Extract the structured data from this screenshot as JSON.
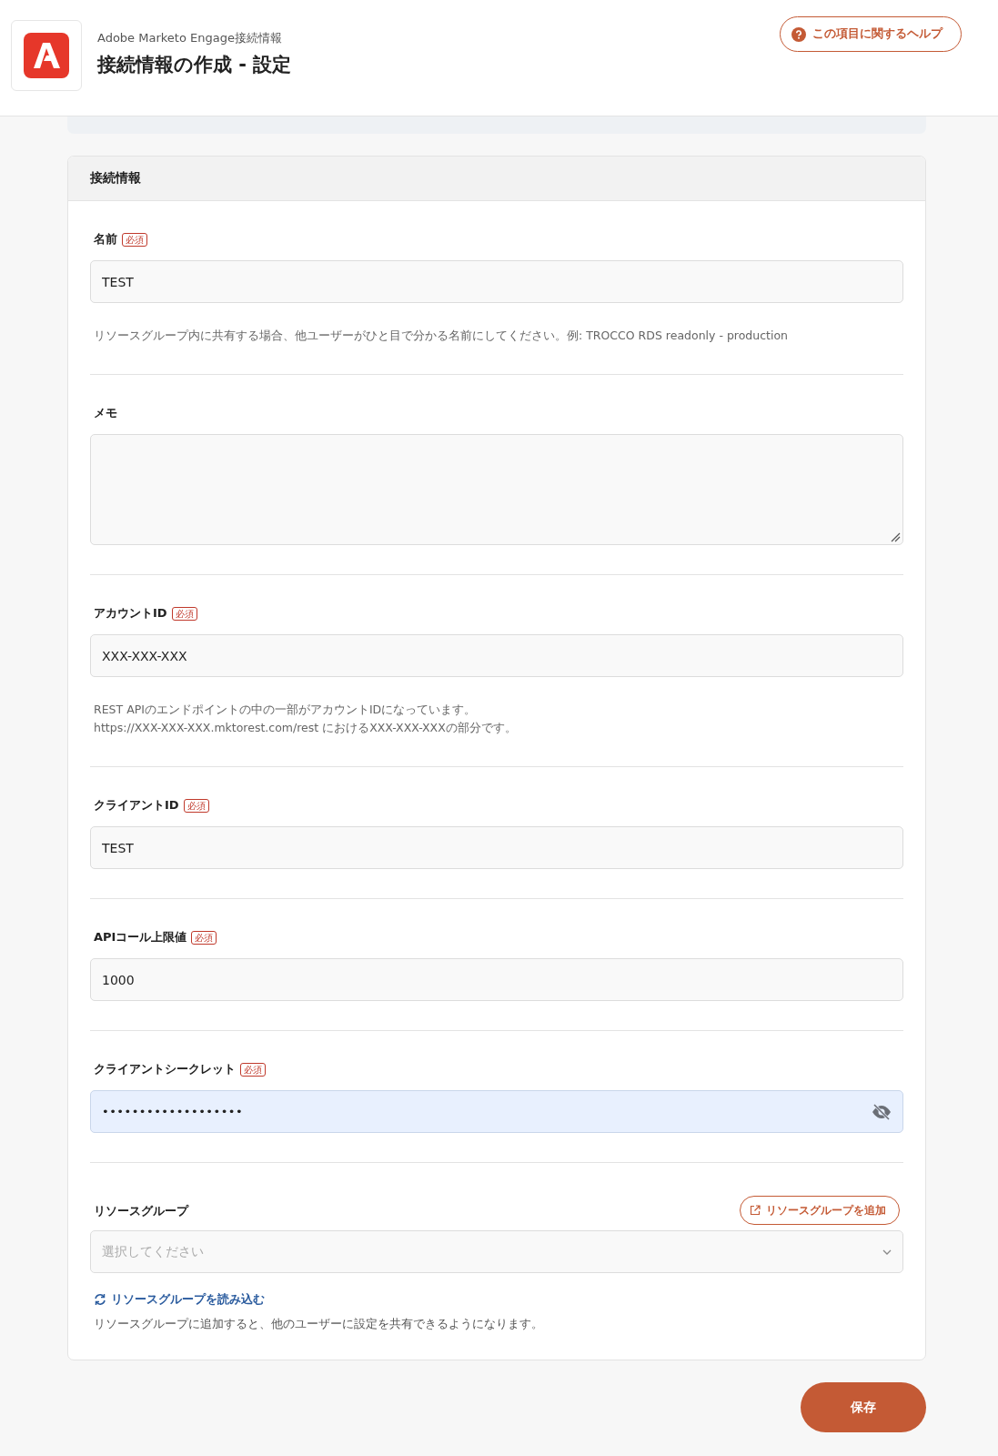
{
  "header": {
    "subtitle": "Adobe Marketo Engage接続情報",
    "title": "接続情報の作成 - 設定",
    "help_button": "この項目に関するヘルプ"
  },
  "card": {
    "title": "接続情報",
    "fields": [
      {
        "kind": "text",
        "label": "名前",
        "required_badge": "必須",
        "value": "TEST",
        "hint": [
          "リソースグループ内に共有する場合、他ユーザーがひと目で分かる名前にしてください。例: TROCCO RDS readonly - production"
        ]
      },
      {
        "kind": "textarea",
        "label": "メモ"
      },
      {
        "kind": "text",
        "label": "アカウントID",
        "required_badge": "必須",
        "value": "XXX-XXX-XXX",
        "hint": [
          "REST APIのエンドポイントの中の一部がアカウントIDになっています。",
          "https://XXX-XXX-XXX.mktorest.com/rest におけるXXX-XXX-XXXの部分です。"
        ]
      },
      {
        "kind": "text",
        "label": "クライアントID",
        "required_badge": "必須",
        "value": "TEST"
      },
      {
        "kind": "text",
        "label": "APIコール上限値",
        "required_badge": "必須",
        "value": "1000"
      },
      {
        "kind": "password",
        "label": "クライアントシークレット",
        "required_badge": "必須",
        "value": "•••••••••••••••••••"
      }
    ],
    "resource_group": {
      "label": "リソースグループ",
      "add_button": "リソースグループを追加",
      "placeholder": "選択してください",
      "reload_link": "リソースグループを読み込む",
      "hint": "リソースグループに追加すると、他のユーザーに設定を共有できるようになります。"
    }
  },
  "save_button": "保存"
}
